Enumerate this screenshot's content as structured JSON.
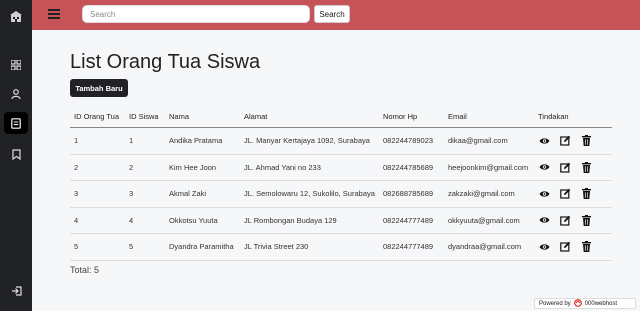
{
  "sidebar": {
    "items": [
      {
        "name": "dashboard-grid-icon",
        "active": false
      },
      {
        "name": "user-icon",
        "active": false
      },
      {
        "name": "document-icon",
        "active": true
      },
      {
        "name": "bookmark-icon",
        "active": false
      }
    ],
    "logout_icon": "logout-icon",
    "logo_icon": "school-building-icon"
  },
  "topbar": {
    "background": "#c65357",
    "search_placeholder": "Search",
    "search_button": "Search"
  },
  "page": {
    "title": "List Orang Tua Siswa",
    "add_button": "Tambah Baru",
    "total": "Total: 5"
  },
  "table": {
    "headers": [
      "ID Orang Tua",
      "ID Siswa",
      "Nama",
      "Alamat",
      "Nomor Hp",
      "Email",
      "Tindakan"
    ],
    "rows": [
      [
        "1",
        "1",
        "Andika Pratama",
        "JL. Manyar Kertajaya 1092, Surabaya",
        "082244789023",
        "dikaa@gmail.com"
      ],
      [
        "2",
        "2",
        "Kim Hee Joon",
        "JL. Ahmad Yani no 233",
        "082244785689",
        "heejoonkim@gmail.com"
      ],
      [
        "3",
        "3",
        "Akmal Zaki",
        "JL. Semolowaru 12, Sukolilo, Surabaya",
        "082688785689",
        "zakzaki@gmail.com"
      ],
      [
        "4",
        "4",
        "Okkotsu Yuuta",
        "JL Rombongan Budaya 129",
        "082244777489",
        "okkyuuta@gmail.com"
      ],
      [
        "5",
        "5",
        "Dyandra Paramitha",
        "JL Trivia Street 230",
        "082244777489",
        "dyandraa@gmail.com"
      ]
    ],
    "actions": [
      "eye-icon",
      "edit-icon",
      "trash-icon"
    ]
  },
  "footer": {
    "powered_by": "Powered by",
    "host": "000webhost"
  }
}
